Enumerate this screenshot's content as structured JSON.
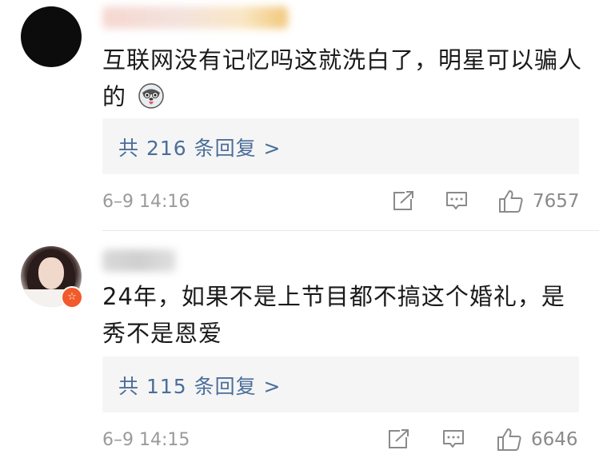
{
  "comments": [
    {
      "username": "",
      "text": "互联网没有记忆吗这就洗白了，明星可以骗人的",
      "replies_label": "共 216 条回复 >",
      "timestamp": "6–9 14:16",
      "likes": "7657",
      "emoji": "husky-tongue-emoji",
      "avatar": "dark-avatar"
    },
    {
      "username": "",
      "text": "24年，如果不是上节目都不搞这个婚礼，是秀不是恩爱",
      "replies_label": "共 115 条回复 >",
      "timestamp": "6–9 14:15",
      "likes": "6646",
      "avatar": "photo-avatar",
      "badge": "☆"
    }
  ],
  "colors": {
    "link": "#4a6e9a",
    "meta": "#9a9a9a",
    "reply_bg": "#f5f5f5",
    "badge": "#f25a2a"
  }
}
